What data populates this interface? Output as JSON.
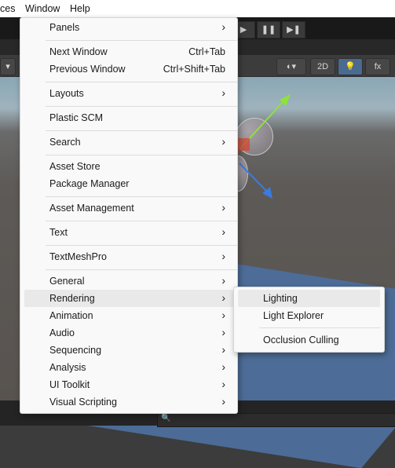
{
  "menubar": {
    "items": [
      "ces",
      "Window",
      "Help"
    ]
  },
  "playbar": {
    "play": "▶",
    "pause": "❚❚",
    "step": "▶❚"
  },
  "scene_toolbar": {
    "mode_2d": "2D",
    "lighting_icon": "💡",
    "fx_icon": "fx"
  },
  "window_menu": {
    "items": [
      {
        "label": "Panels",
        "submenu": true
      },
      {
        "label": "Next Window",
        "shortcut": "Ctrl+Tab"
      },
      {
        "label": "Previous Window",
        "shortcut": "Ctrl+Shift+Tab"
      },
      {
        "label": "Layouts",
        "submenu": true
      },
      {
        "label": "Plastic SCM"
      },
      {
        "label": "Search",
        "submenu": true
      },
      {
        "label": "Asset Store"
      },
      {
        "label": "Package Manager"
      },
      {
        "label": "Asset Management",
        "submenu": true
      },
      {
        "label": "Text",
        "submenu": true
      },
      {
        "label": "TextMeshPro",
        "submenu": true
      },
      {
        "label": "General",
        "submenu": true
      },
      {
        "label": "Rendering",
        "submenu": true,
        "highlighted": true
      },
      {
        "label": "Animation",
        "submenu": true
      },
      {
        "label": "Audio",
        "submenu": true
      },
      {
        "label": "Sequencing",
        "submenu": true
      },
      {
        "label": "Analysis",
        "submenu": true
      },
      {
        "label": "UI Toolkit",
        "submenu": true
      },
      {
        "label": "Visual Scripting",
        "submenu": true
      }
    ],
    "arrow": "›"
  },
  "rendering_submenu": {
    "items": [
      {
        "label": "Lighting",
        "highlighted": true
      },
      {
        "label": "Light Explorer"
      },
      {
        "label": "Occlusion Culling"
      }
    ]
  }
}
